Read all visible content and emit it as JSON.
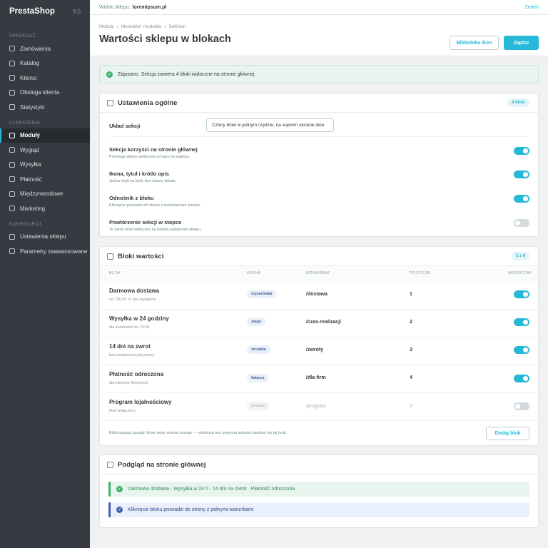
{
  "sidebar": {
    "brand": "PrestaShop",
    "version": "9.0",
    "sections": [
      {
        "label": "SPRZEDAŻ",
        "items": [
          "Zamówienia",
          "Katalog",
          "Klienci",
          "Obsługa klienta",
          "Statystyki"
        ]
      },
      {
        "label": "ULEPSZENIA",
        "items": [
          "Moduły",
          "Wygląd",
          "Wysyłka",
          "Płatność",
          "Międzynarodowe",
          "Marketing"
        ]
      },
      {
        "label": "KONFIGURUJ",
        "items": [
          "Ustawienia sklepu",
          "Parametry zaawansowane"
        ]
      }
    ],
    "active_item": "Moduły"
  },
  "topbar": {
    "shop_label": "Widok sklepu:",
    "shop_url": "loremipsum.pl",
    "change_label": "Zmień"
  },
  "header": {
    "breadcrumb": [
      "Moduły",
      "Menedżer modułów",
      "Sellision"
    ],
    "title": "Wartości sklepu w blokach",
    "icon_library_label": "Biblioteka ikon",
    "save_label": "Zapisz"
  },
  "alert": {
    "text": "Zapisano. Sekcja zawiera 4 bloki widoczne na stronie głównej."
  },
  "general": {
    "title": "Ustawienia ogólne",
    "badge": "4 bloki",
    "layout_label": "Układ sekcji",
    "layout_value": "Cztery bloki w jednym rzędzie, na wąskim ekranie dwa",
    "options": [
      {
        "title": "Sekcja korzyści na stronie głównej",
        "desc": "Przewagi sklepu widoczne od razu po wejściu.",
        "on": true
      },
      {
        "title": "Ikona, tytuł i krótki opis",
        "desc": "Jedna myśl na blok, bez ściany tekstu.",
        "on": true
      },
      {
        "title": "Odnośnik z bloku",
        "desc": "Kliknięcie prowadzi do strony z rozwinięciem tematu.",
        "on": true
      },
      {
        "title": "Powtórzenie sekcji w stopce",
        "desc": "Te same bloki widoczne na każdej podstronie sklepu.",
        "on": false
      }
    ]
  },
  "blocks": {
    "title": "Bloki wartości",
    "badge": "5 z 6",
    "columns": [
      "BLOK",
      "IKONA",
      "ODNOŚNIK",
      "POZYCJA",
      "WIDOCZNY"
    ],
    "rows": [
      {
        "name": "Darmowa dostawa",
        "sub": "od 700,00 zł, bez wyjątków",
        "icon": "ciężarówka",
        "link": "/dostawa",
        "pos": "1",
        "visible": true
      },
      {
        "name": "Wysyłka w 24 godziny",
        "sub": "dla zamówień do 13:00",
        "icon": "zegar",
        "link": "/czas-realizacji",
        "pos": "2",
        "visible": true
      },
      {
        "name": "14 dni na zwrot",
        "sub": "bez podawania przyczyny",
        "icon": "strzałka",
        "link": "/zwroty",
        "pos": "3",
        "visible": true
      },
      {
        "name": "Płatność odroczona",
        "sub": "dla klientów firmowych",
        "icon": "faktura",
        "link": "/dla-firm",
        "pos": "4",
        "visible": true
      },
      {
        "name": "Program lojalnościowy",
        "sub": "blok wyłączony",
        "icon": "gwiazda",
        "link": "/program",
        "pos": "5",
        "visible": false
      }
    ],
    "footnote": "Bloki opisują zasady, które sklep realnie stosuje — obietnica bez pokrycia szkodzi bardziej niż jej brak.",
    "add_label": "Dodaj blok"
  },
  "preview": {
    "title": "Podgląd na stronie głównej",
    "success_text": "Darmowa dostawa · Wysyłka w 24 h · 14 dni na zwrot · Płatność odroczona",
    "info_text": "Kliknięcie bloku prowadzi do strony z pełnymi warunkami"
  }
}
